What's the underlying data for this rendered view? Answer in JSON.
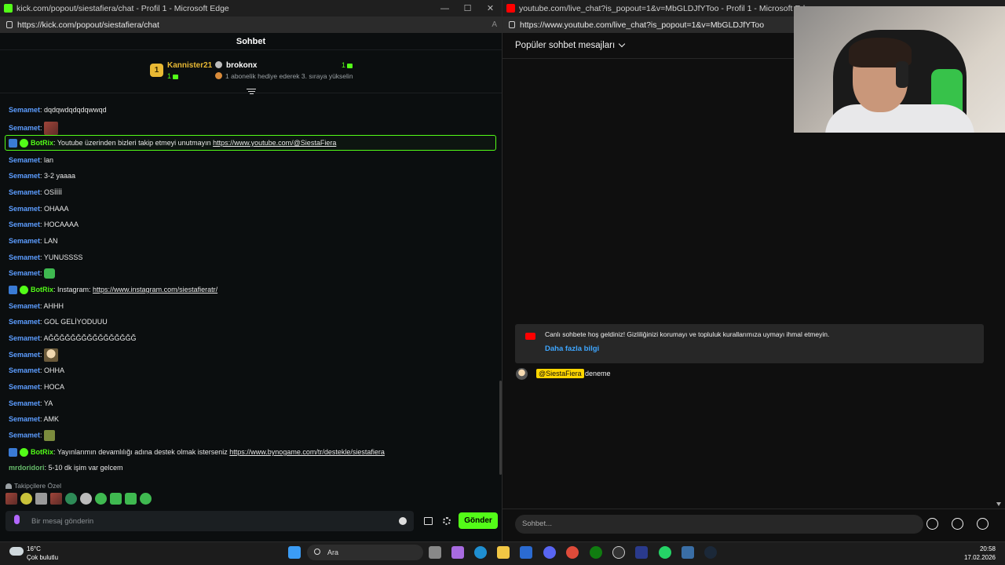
{
  "left_window": {
    "title": "kick.com/popout/siestafiera/chat - Profil 1 - Microsoft Edge",
    "url": "https://kick.com/popout/siestafiera/chat",
    "header": "Sohbet",
    "gifters": {
      "first_rank": "1",
      "first_name": "Kannister21",
      "first_count": "1",
      "second_name": "brokonx",
      "second_count": "1",
      "second_sub": "1 abonelik hediye ederek 3. sıraya yükselin"
    },
    "messages": [
      {
        "user": "Semamet",
        "text": ": dqdqwdqdqdqwwqd"
      },
      {
        "user": "Semamet",
        "text": ":"
      },
      {
        "user": "BotRix",
        "text": ": Youtube üzerinden bizleri takip etmeyi unutmayın ",
        "link": "https://www.youtube.com/@SiestaFiera"
      },
      {
        "user": "Semamet",
        "text": ": lan"
      },
      {
        "user": "Semamet",
        "text": ": 3-2 yaaaa"
      },
      {
        "user": "Semamet",
        "text": ": OSİİİİ"
      },
      {
        "user": "Semamet",
        "text": ": OHAAA"
      },
      {
        "user": "Semamet",
        "text": ": HOCAAAA"
      },
      {
        "user": "Semamet",
        "text": ": LAN"
      },
      {
        "user": "Semamet",
        "text": ": YUNUSSSS"
      },
      {
        "user": "Semamet",
        "text": ":"
      },
      {
        "user": "BotRix",
        "text": ": Instagram: ",
        "link": "https://www.instagram.com/siestafieratr/"
      },
      {
        "user": "Semamet",
        "text": ": AHHH"
      },
      {
        "user": "Semamet",
        "text": ": GOL GELİYODUUU"
      },
      {
        "user": "Semamet",
        "text": ": AĞĞĞĞĞĞĞĞĞĞĞĞĞĞĞĞ"
      },
      {
        "user": "Semamet",
        "text": ":"
      },
      {
        "user": "Semamet",
        "text": ": OHHA"
      },
      {
        "user": "Semamet",
        "text": ": HOCA"
      },
      {
        "user": "Semamet",
        "text": ": YA"
      },
      {
        "user": "Semamet",
        "text": ": AMK"
      },
      {
        "user": "Semamet",
        "text": ":"
      },
      {
        "user": "BotRix",
        "text": ": Yayınlarımın devamlılığı adına destek olmak isterseniz ",
        "link": "https://www.bynogame.com/tr/destekle/siestafiera"
      },
      {
        "user": "mrdoridori",
        "text": ": 5-10 dk işim var gelcem"
      }
    ],
    "followers_label": "Takipçilere Özel",
    "input_placeholder": "Bir mesaj gönderin",
    "send_label": "Gönder"
  },
  "right_window": {
    "title": "youtube.com/live_chat?is_popout=1&v=MbGLDJfYToo - Profil 1 - Microsoft Edge",
    "url": "https://www.youtube.com/live_chat?is_popout=1&v=MbGLDJfYToo",
    "header": "Popüler sohbet mesajları",
    "welcome_text": "Canlı sohbete hoş geldiniz! Gizliliğinizi korumayı ve topluluk kurallarımıza uymayı ihmal etmeyin.",
    "learn_more": "Daha fazla bilgi",
    "message_author": "@SiestaFiera",
    "message_text": "deneme",
    "input_placeholder": "Sohbet..."
  },
  "taskbar": {
    "temperature": "16°C",
    "weather": "Çok bulutlu",
    "search": "Ara",
    "time": "20:58",
    "date": "17.02.2026"
  },
  "colors": {
    "kick_green": "#53fc18",
    "kick_user": "#5c9dff",
    "youtube_red": "#ff0000",
    "youtube_link": "#3ea6ff"
  }
}
